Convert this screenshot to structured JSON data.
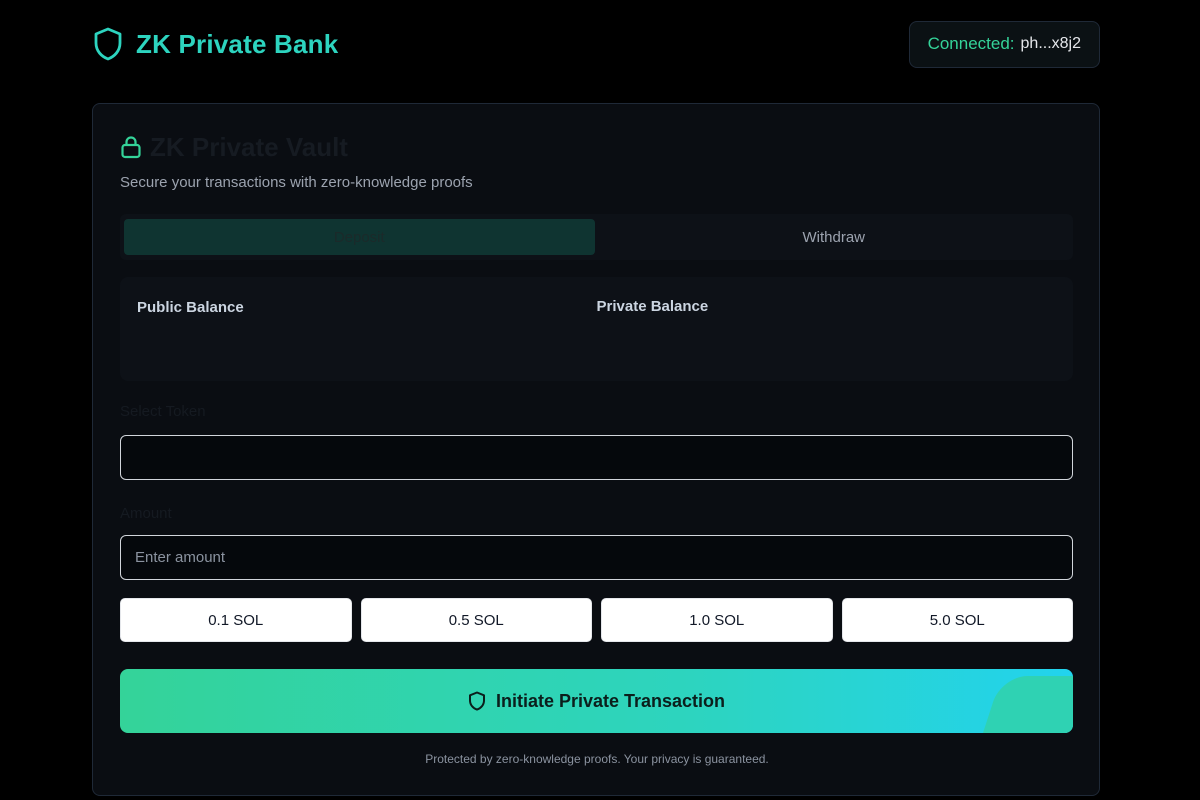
{
  "header": {
    "brand_icon": "shield-icon",
    "title": "ZK Private Bank",
    "wallet": {
      "label": "Connected:",
      "address": "ph...x8j2"
    }
  },
  "vault": {
    "icon": "lock-icon",
    "title": "ZK Private Vault",
    "subtitle": "Secure your transactions with zero-knowledge proofs",
    "tabs": [
      {
        "label": "Deposit",
        "active": true
      },
      {
        "label": "Withdraw",
        "active": false
      }
    ],
    "balances": {
      "public_label": "Public Balance",
      "public_value": "",
      "private_label": "Private Balance",
      "private_value": ""
    },
    "token": {
      "label": "Select Token",
      "selected": ""
    },
    "amount": {
      "label": "Amount",
      "placeholder": "Enter amount",
      "value": ""
    },
    "quick_amounts": [
      "0.1 SOL",
      "0.5 SOL",
      "1.0 SOL",
      "5.0 SOL"
    ],
    "submit": {
      "icon": "shield-icon",
      "label": "Initiate Private Transaction"
    },
    "footnote": "Protected by zero-knowledge proofs. Your privacy is guaranteed."
  },
  "colors": {
    "background": "#000000",
    "card": "#0a0d12",
    "accent": "#2dd4bf",
    "accent_green": "#34d399",
    "accent_cyan": "#22d3ee",
    "tab_active": "#0f3431"
  }
}
